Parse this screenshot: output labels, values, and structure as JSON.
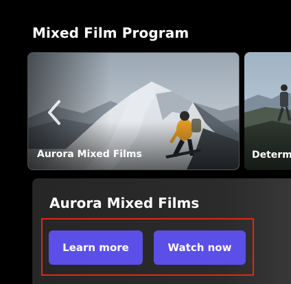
{
  "section": {
    "title": "Mixed Film Program"
  },
  "carousel": {
    "cards": [
      {
        "label": "Aurora Mixed Films"
      },
      {
        "label": "Determ"
      }
    ],
    "prev_icon": "chevron-left-icon"
  },
  "details": {
    "title": "Aurora Mixed Films",
    "learn_more_label": "Learn more",
    "watch_now_label": "Watch now",
    "button_color": "#5b4fe8",
    "highlight_color": "#e02914"
  }
}
